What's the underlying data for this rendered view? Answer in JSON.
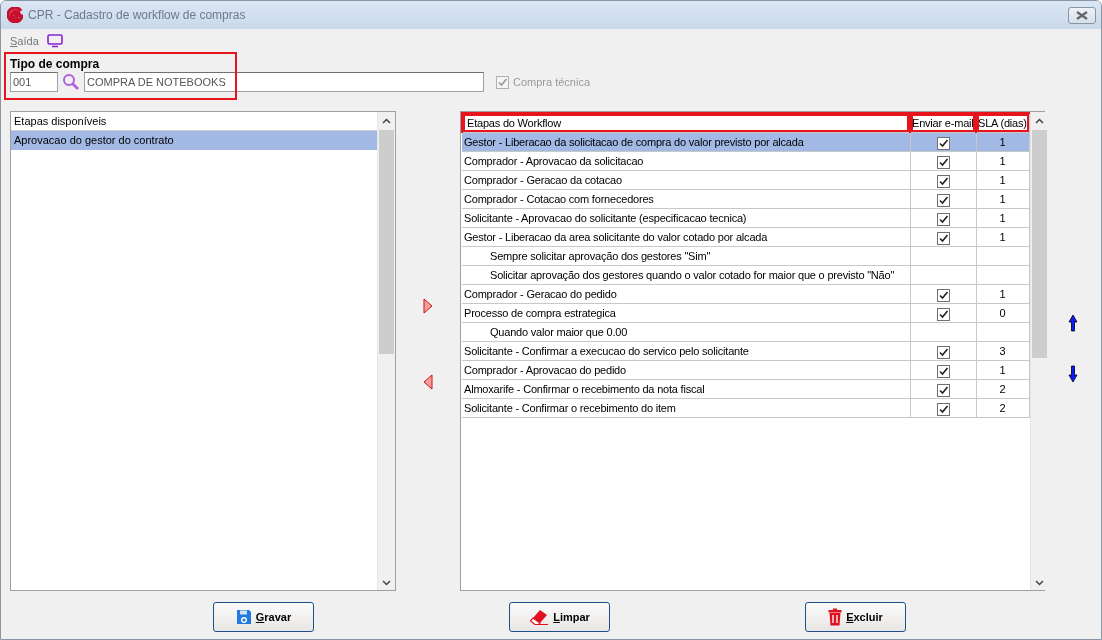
{
  "window": {
    "title": "CPR - Cadastro de workflow de compras"
  },
  "menu": [
    {
      "label": "Saída"
    }
  ],
  "tipo_compra": {
    "label": "Tipo de compra",
    "code": "001",
    "description": "COMPRA DE NOTEBOOKS",
    "highlighted": true,
    "technical": {
      "label": "Compra técnica",
      "checked": true,
      "disabled": true
    }
  },
  "available_steps": {
    "header": "Etapas disponíveis",
    "items": [
      {
        "label": "Aprovacao do gestor do contrato",
        "selected": true
      }
    ]
  },
  "workflow": {
    "columns": [
      {
        "label": "Etapas do Workflow",
        "highlighted": true
      },
      {
        "label": "Enviar e-mail",
        "highlighted": true
      },
      {
        "label": "SLA (dias)",
        "highlighted": true
      }
    ],
    "rows": [
      {
        "kind": "step",
        "label": "Gestor - Liberacao da solicitacao de compra do valor previsto por alcada",
        "email": true,
        "sla": "1",
        "selected": true
      },
      {
        "kind": "step",
        "label": "Comprador - Aprovacao da solicitacao",
        "email": true,
        "sla": "1",
        "selected": false
      },
      {
        "kind": "step",
        "label": "Comprador - Geracao da cotacao",
        "email": true,
        "sla": "1",
        "selected": false
      },
      {
        "kind": "step",
        "label": "Comprador - Cotacao com fornecedores",
        "email": true,
        "sla": "1",
        "selected": false
      },
      {
        "kind": "step",
        "label": "Solicitante - Aprovacao do solicitante (especificacao tecnica)",
        "email": true,
        "sla": "1",
        "selected": false
      },
      {
        "kind": "step",
        "label": "Gestor - Liberacao da area solicitante do valor cotado por alcada",
        "email": true,
        "sla": "1",
        "selected": false
      },
      {
        "kind": "note",
        "label": "Sempre solicitar aprovação dos gestores \"Sim\""
      },
      {
        "kind": "note",
        "label": "Solicitar aprovação dos gestores quando o valor cotado for maior que o previsto \"Não\""
      },
      {
        "kind": "step",
        "label": "Comprador - Geracao do pedido",
        "email": true,
        "sla": "1",
        "selected": false
      },
      {
        "kind": "step",
        "label": "Processo de compra estrategica",
        "email": true,
        "sla": "0",
        "selected": false
      },
      {
        "kind": "note",
        "label": "Quando valor maior que 0.00"
      },
      {
        "kind": "step",
        "label": "Solicitante - Confirmar a execucao do servico pelo solicitante",
        "email": true,
        "sla": "3",
        "selected": false
      },
      {
        "kind": "step",
        "label": "Comprador - Aprovacao do pedido",
        "email": true,
        "sla": "1",
        "selected": false
      },
      {
        "kind": "step",
        "label": "Almoxarife - Confirmar o recebimento da nota fiscal",
        "email": true,
        "sla": "2",
        "selected": false
      },
      {
        "kind": "step",
        "label": "Solicitante - Confirmar o recebimento do item",
        "email": true,
        "sla": "2",
        "selected": false
      }
    ]
  },
  "buttons": [
    {
      "kind": "save",
      "label": "Gravar"
    },
    {
      "kind": "clear",
      "label": "Limpar"
    },
    {
      "kind": "delete",
      "label": "Excluir"
    }
  ]
}
